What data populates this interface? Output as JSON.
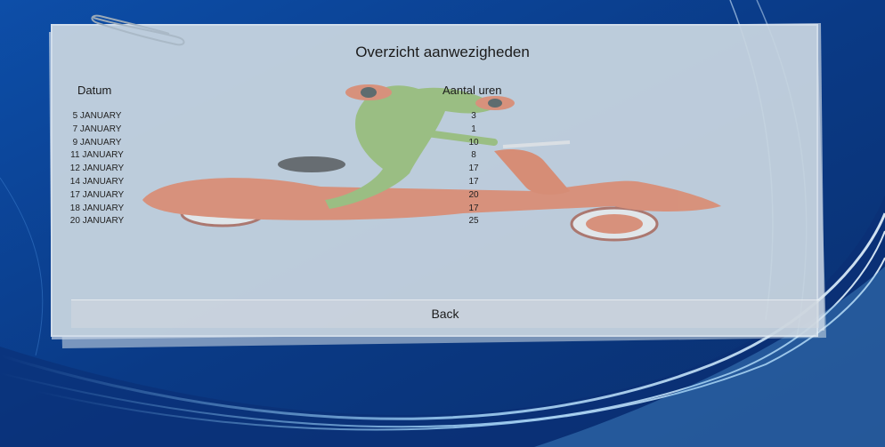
{
  "page": {
    "title": "Overzicht aanwezigheden"
  },
  "table": {
    "headers": [
      "Datum",
      "Aantal uren"
    ],
    "rows": [
      {
        "date": "5 JANUARY",
        "hours": "3"
      },
      {
        "date": "7 JANUARY",
        "hours": "1"
      },
      {
        "date": "9 JANUARY",
        "hours": "10"
      },
      {
        "date": "11 JANUARY",
        "hours": "8"
      },
      {
        "date": "12 JANUARY",
        "hours": "17"
      },
      {
        "date": "14 JANUARY",
        "hours": "17"
      },
      {
        "date": "17 JANUARY",
        "hours": "20"
      },
      {
        "date": "18 JANUARY",
        "hours": "17"
      },
      {
        "date": "20 JANUARY",
        "hours": "25"
      }
    ]
  },
  "actions": {
    "back_label": "Back"
  },
  "colors": {
    "background_blue": "#0a3c8e",
    "paper": "#c9d6e1",
    "scooter": "#e2683e",
    "frog": "#7fb04a"
  },
  "icons": {
    "paperclip": "paperclip-icon"
  }
}
